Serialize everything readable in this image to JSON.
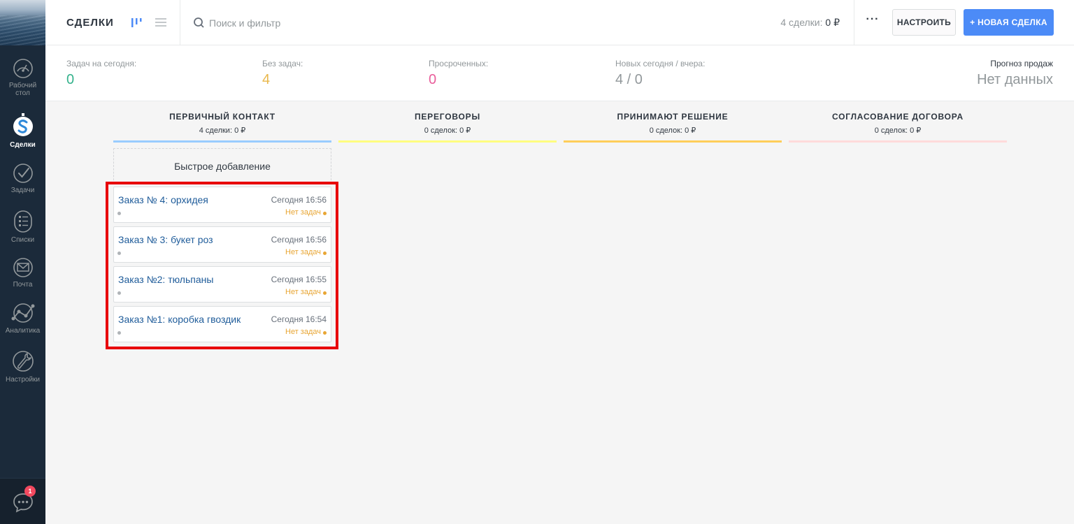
{
  "sidebar": {
    "items": [
      {
        "label": "Рабочий стол",
        "icon": "dashboard-icon"
      },
      {
        "label": "Сделки",
        "icon": "deals-icon"
      },
      {
        "label": "Задачи",
        "icon": "tasks-icon"
      },
      {
        "label": "Списки",
        "icon": "lists-icon"
      },
      {
        "label": "Почта",
        "icon": "mail-icon"
      },
      {
        "label": "Аналитика",
        "icon": "analytics-icon"
      },
      {
        "label": "Настройки",
        "icon": "settings-icon"
      }
    ],
    "active": "Сделки",
    "chat_badge": "1"
  },
  "header": {
    "title": "СДЕЛКИ",
    "search_placeholder": "Поиск и фильтр",
    "deals_count": "4 сделки:",
    "deals_sum": "0 ₽",
    "more": "···",
    "setup_label": "НАСТРОИТЬ",
    "new_deal_label": "+ НОВАЯ СДЕЛКА"
  },
  "stats": {
    "today_tasks_label": "Задач на сегодня:",
    "today_tasks_value": "0",
    "no_tasks_label": "Без задач:",
    "no_tasks_value": "4",
    "overdue_label": "Просроченных:",
    "overdue_value": "0",
    "new_label": "Новых сегодня / вчера:",
    "new_value": "4 / 0",
    "forecast_label": "Прогноз продаж",
    "forecast_value": "Нет данных"
  },
  "colors": {
    "accent": "#4c8bf7",
    "today_tasks": "#35b28c",
    "no_tasks": "#e9b84c",
    "overdue": "#e95e9b",
    "highlight": "#e8000b"
  },
  "pipeline": {
    "quick_add": "Быстрое добавление",
    "columns": [
      {
        "title": "ПЕРВИЧНЫЙ КОНТАКТ",
        "summary": "4 сделки: 0 ₽",
        "color": "#99ccff"
      },
      {
        "title": "ПЕРЕГОВОРЫ",
        "summary": "0 сделок: 0 ₽",
        "color": "#fffd7f"
      },
      {
        "title": "ПРИНИМАЮТ РЕШЕНИЕ",
        "summary": "0 сделок: 0 ₽",
        "color": "#ffce5a"
      },
      {
        "title": "СОГЛАСОВАНИЕ ДОГОВОРА",
        "summary": "0 сделок: 0 ₽",
        "color": "#ffdbdb"
      }
    ],
    "cards": [
      {
        "title": "Заказ № 4: орхидея",
        "date": "Сегодня 16:56",
        "tasks": "Нет задач"
      },
      {
        "title": "Заказ № 3: букет роз",
        "date": "Сегодня 16:56",
        "tasks": "Нет задач"
      },
      {
        "title": "Заказ №2: тюльпаны",
        "date": "Сегодня 16:55",
        "tasks": "Нет задач"
      },
      {
        "title": "Заказ №1: коробка гвоздик",
        "date": "Сегодня 16:54",
        "tasks": "Нет задач"
      }
    ]
  }
}
